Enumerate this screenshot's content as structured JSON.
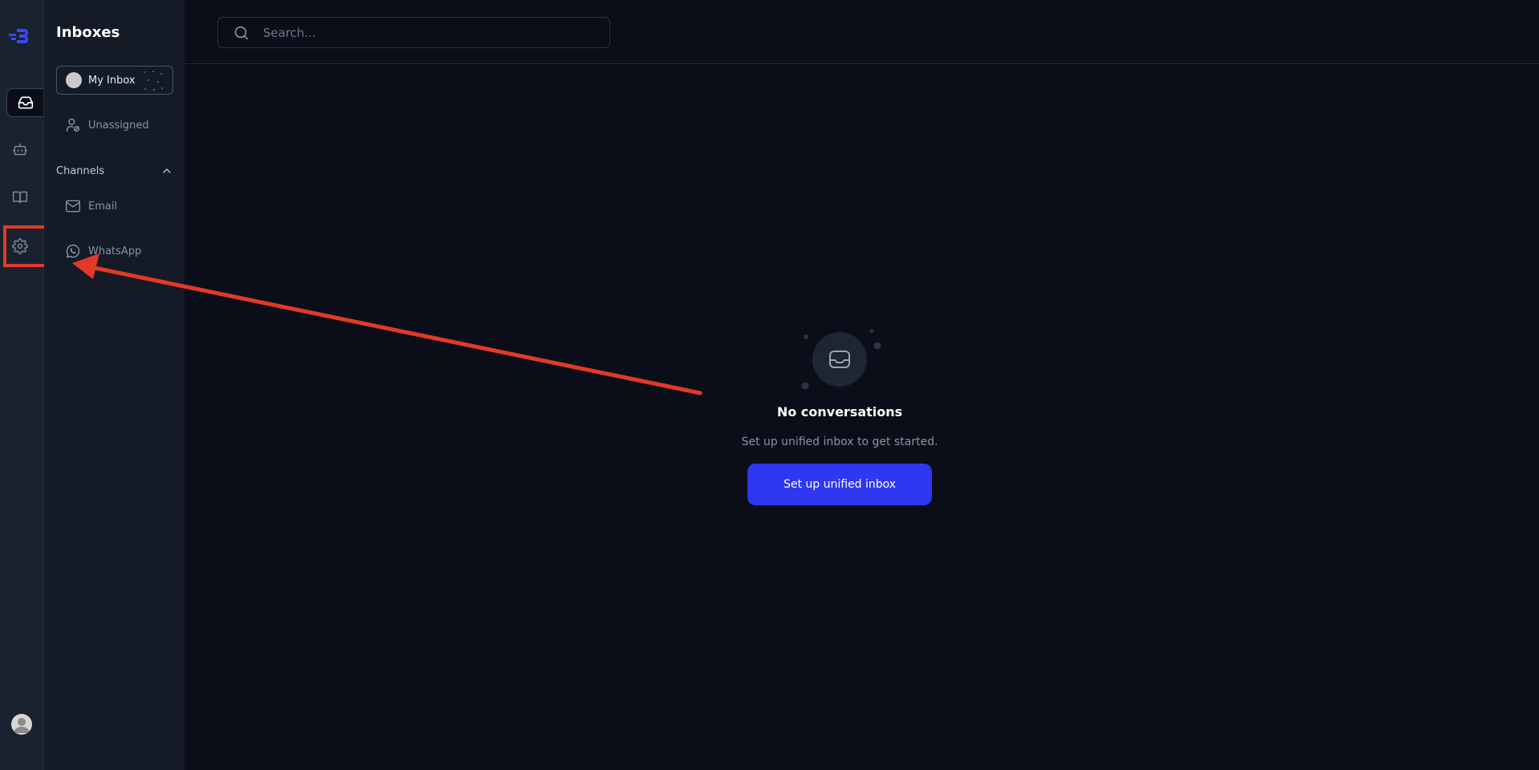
{
  "sidebar": {
    "title": "Inboxes",
    "my_inbox_label": "My Inbox",
    "unassigned_label": "Unassigned",
    "channels_label": "Channels",
    "channels": [
      {
        "label": "Email",
        "icon": "mail-icon"
      },
      {
        "label": "WhatsApp",
        "icon": "whatsapp-icon"
      }
    ]
  },
  "rail": {
    "items": [
      {
        "name": "inbox",
        "icon": "inbox-icon",
        "active": true
      },
      {
        "name": "bot",
        "icon": "bot-icon",
        "active": false
      },
      {
        "name": "knowledge",
        "icon": "book-icon",
        "active": false
      },
      {
        "name": "settings",
        "icon": "gear-icon",
        "active": false,
        "highlighted": true
      }
    ]
  },
  "search": {
    "placeholder": "Search..."
  },
  "empty_state": {
    "title": "No conversations",
    "subtitle": "Set up unified inbox to get started.",
    "button_label": "Set up unified inbox"
  },
  "colors": {
    "accent": "#3037f0",
    "annotation": "#e23a26",
    "background": "#0b0e18"
  }
}
